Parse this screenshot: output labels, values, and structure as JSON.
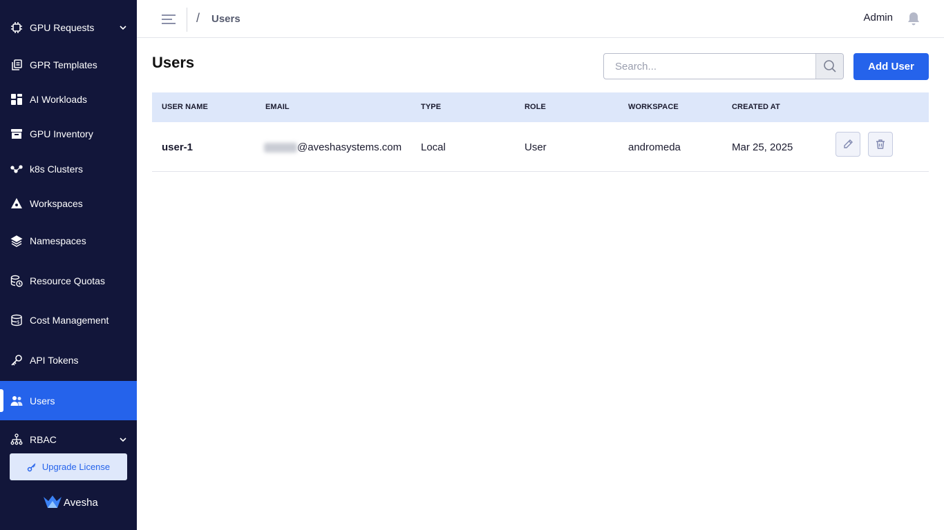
{
  "sidebar": {
    "items": [
      {
        "label": "GPU Requests",
        "icon": "chip-icon"
      },
      {
        "label": "GPR Templates",
        "icon": "copy-icon"
      },
      {
        "label": "AI Workloads",
        "icon": "dashboard-icon"
      },
      {
        "label": "GPU Inventory",
        "icon": "inventory-icon"
      },
      {
        "label": "k8s Clusters",
        "icon": "cluster-icon"
      },
      {
        "label": "Workspaces",
        "icon": "workspace-icon"
      },
      {
        "label": "Namespaces",
        "icon": "layers-icon"
      },
      {
        "label": "Resource Quotas",
        "icon": "quota-icon"
      },
      {
        "label": "Cost Management",
        "icon": "cost-icon"
      },
      {
        "label": "API Tokens",
        "icon": "key-icon"
      },
      {
        "label": "Users",
        "icon": "users-icon"
      },
      {
        "label": "RBAC",
        "icon": "rbac-icon"
      }
    ],
    "upgrade_label": "Upgrade License",
    "brand_name": "Avesha"
  },
  "header": {
    "breadcrumb_separator": "/",
    "breadcrumb_current": "Users",
    "user_label": "Admin"
  },
  "main": {
    "title": "Users",
    "search_placeholder": "Search...",
    "add_button_label": "Add User",
    "columns": [
      "USER NAME",
      "EMAIL",
      "TYPE",
      "ROLE",
      "WORKSPACE",
      "CREATED AT"
    ],
    "rows": [
      {
        "user_name": "user-1",
        "email": "@aveshasystems.com",
        "type": "Local",
        "role": "User",
        "workspace": "andromeda",
        "created_at": "Mar 25, 2025"
      }
    ]
  },
  "colors": {
    "sidebar_bg": "#12163a",
    "accent": "#2563eb",
    "table_header_bg": "#dde7fa"
  }
}
